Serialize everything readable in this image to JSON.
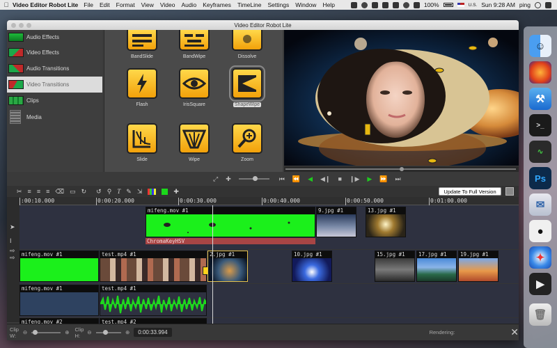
{
  "menubar": {
    "app_name": "Video Editor Robot Lite",
    "items": [
      "File",
      "Edit",
      "Format",
      "View",
      "Video",
      "Audio",
      "Keyframes",
      "TimeLine",
      "Settings",
      "Window",
      "Help"
    ],
    "battery": "100%",
    "input_source": "U.S.",
    "clock": "Sun 9:28 AM",
    "user": "ping"
  },
  "window": {
    "title": "Video Editor Robot Lite"
  },
  "sidebar": {
    "items": [
      {
        "label": "Audio Effects",
        "icon": "audio-effects-icon"
      },
      {
        "label": "Video Effects",
        "icon": "video-effects-icon"
      },
      {
        "label": "Audio Transitions",
        "icon": "audio-transitions-icon"
      },
      {
        "label": "Video Transitions",
        "icon": "video-transitions-icon",
        "selected": true
      },
      {
        "label": "Clips",
        "icon": "clips-icon"
      },
      {
        "label": "Media",
        "icon": "media-icon"
      }
    ]
  },
  "transitions": {
    "tiles": [
      {
        "label": "BandSlide",
        "icon": "bandslide-icon"
      },
      {
        "label": "BandWipe",
        "icon": "bandwipe-icon"
      },
      {
        "label": "Dissolve",
        "icon": "dissolve-icon"
      },
      {
        "label": "Flash",
        "icon": "flash-icon"
      },
      {
        "label": "IrisSquare",
        "icon": "irissquare-icon"
      },
      {
        "label": "ShapeWipe",
        "icon": "shapewipe-icon",
        "selected": true
      },
      {
        "label": "Slide",
        "icon": "slide-icon"
      },
      {
        "label": "Wipe",
        "icon": "wipe-icon"
      },
      {
        "label": "Zoom",
        "icon": "zoom-icon"
      }
    ]
  },
  "preview": {
    "seek_position": 0.5
  },
  "toolbar": {
    "update_button": "Update To Full Version"
  },
  "ruler": {
    "labels": [
      ":00:10.000",
      "0:00:20.000",
      "0:00:30.000",
      "0:00:40.000",
      "0:00:50.000",
      "0:01:00.000"
    ]
  },
  "tracks": {
    "overlay": [
      {
        "label": "mifeng.mov #1"
      },
      {
        "label": "9.jpg #1"
      },
      {
        "label": "13.jpg #1"
      }
    ],
    "effect_label": "ChromaKeyHSV",
    "video": [
      {
        "label": "mifeng.mov #1"
      },
      {
        "label": "test.mp4 #1"
      },
      {
        "label": "2.jpg #1"
      },
      {
        "label": "10.jpg #1"
      },
      {
        "label": "15.jpg #1"
      },
      {
        "label": "17.jpg #1"
      },
      {
        "label": "19.jpg #1"
      }
    ],
    "audio": [
      {
        "label": "mifeng.mov #1"
      },
      {
        "label": "test.mp4 #1"
      }
    ],
    "audio2": [
      {
        "label": "mifeng.mov #2"
      },
      {
        "label": "test.mp4 #2"
      }
    ]
  },
  "status": {
    "clip_w": "Clip W:",
    "clip_h": "Clip H:",
    "time": "0:00:33.994",
    "rendering": "Rendering:"
  },
  "colors": {
    "accent_green": "#1bf01b",
    "icon_yellow": "#f2a10a",
    "effect_red": "#a84545"
  }
}
